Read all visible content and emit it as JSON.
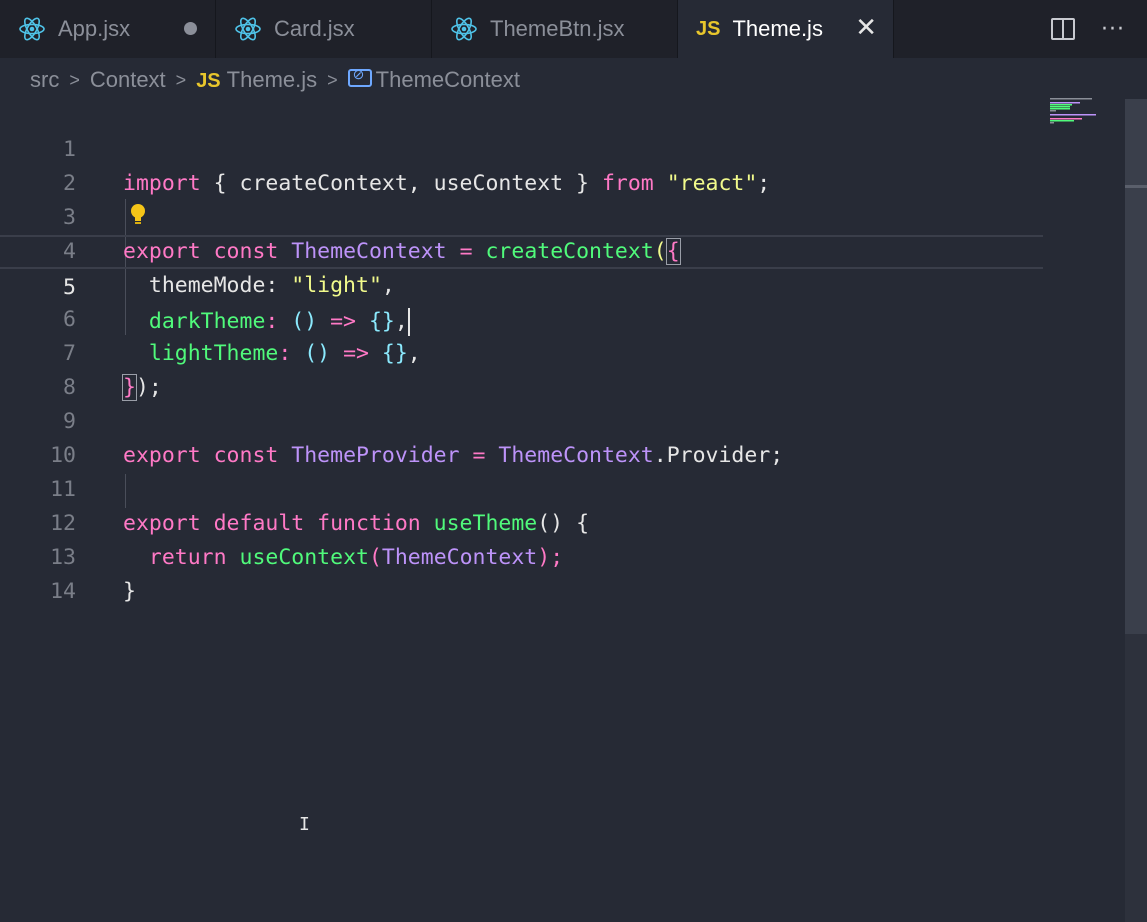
{
  "tabs": [
    {
      "label": "App.jsx",
      "icon": "react-icon",
      "modified": true
    },
    {
      "label": "Card.jsx",
      "icon": "react-icon"
    },
    {
      "label": "ThemeBtn.jsx",
      "icon": "react-icon"
    },
    {
      "label": "Theme.js",
      "icon": "js-icon",
      "badge": "JS",
      "active": true
    }
  ],
  "tab_actions": {
    "close": "✕",
    "split": "split-editor-icon",
    "more": "···"
  },
  "breadcrumb": {
    "items": [
      "src",
      "Context",
      "Theme.js",
      "ThemeContext"
    ],
    "js_badge": "JS",
    "separator": ">"
  },
  "editor": {
    "current_line": 5,
    "line_numbers": [
      "1",
      "2",
      "3",
      "4",
      "5",
      "6",
      "7",
      "8",
      "9",
      "10",
      "11",
      "12",
      "13",
      "14"
    ],
    "code": {
      "l1": {
        "kw_import": "import",
        "p1": " { createContext, useContext } ",
        "kw_from": "from",
        "s1": " ",
        "str": "\"react\"",
        "end": ";"
      },
      "l3": {
        "kw": "export const",
        "s1": " ",
        "cls": "ThemeContext",
        "op": " = ",
        "fn": "createContext",
        "p1": "(",
        "brace": "{"
      },
      "l4": {
        "prop": "themeMode",
        "p1": ": ",
        "str": "\"light\"",
        "end": ","
      },
      "l5": {
        "prop": "darkTheme",
        "colon": ": ",
        "par": "()",
        "arrow": " => ",
        "obj": "{}",
        "end": ","
      },
      "l6": {
        "prop": "lightTheme",
        "colon": ": ",
        "par": "()",
        "arrow": " => ",
        "obj": "{}",
        "end": ","
      },
      "l7": {
        "brace": "}",
        "end": ");"
      },
      "l9": {
        "kw": "export const",
        "s1": " ",
        "cls1": "ThemeProvider",
        "op": " = ",
        "cls2": "ThemeContext",
        "rest": ".Provider;"
      },
      "l11": {
        "kw": "export default function",
        "s1": " ",
        "fn": "useTheme",
        "rest": "() {"
      },
      "l12": {
        "kw": "return",
        "s1": " ",
        "fn": "useContext",
        "p1": "(",
        "cls": "ThemeContext",
        "end": ");"
      },
      "l13": {
        "brace": "}"
      }
    }
  },
  "colors": {
    "background": "#262a35",
    "tabbar": "#1f2129",
    "keyword": "#ff79c6",
    "function": "#50fa7b",
    "class": "#bd93f9",
    "string": "#f1fa8c",
    "paren": "#8be9fd",
    "js_badge": "#e8c62c"
  }
}
